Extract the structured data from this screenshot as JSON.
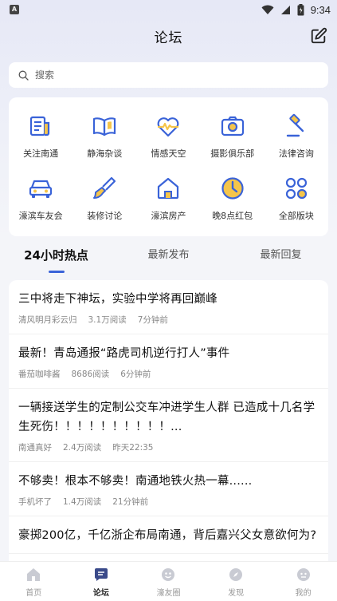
{
  "status_bar": {
    "time": "9:34",
    "left_badge": "A"
  },
  "nav": {
    "title": "论坛"
  },
  "search": {
    "placeholder": "搜索"
  },
  "categories": [
    {
      "label": "关注南通",
      "icon": "newspaper-icon"
    },
    {
      "label": "静海杂谈",
      "icon": "open-book-icon"
    },
    {
      "label": "情感天空",
      "icon": "heartbeat-icon"
    },
    {
      "label": "摄影俱乐部",
      "icon": "camera-icon"
    },
    {
      "label": "法律咨询",
      "icon": "gavel-icon"
    },
    {
      "label": "濠滨车友会",
      "icon": "car-icon"
    },
    {
      "label": "装修讨论",
      "icon": "paint-brush-icon"
    },
    {
      "label": "濠滨房产",
      "icon": "house-icon"
    },
    {
      "label": "晚8点红包",
      "icon": "clock-icon"
    },
    {
      "label": "全部版块",
      "icon": "grid-icon"
    }
  ],
  "tabs": [
    {
      "label": "24小时热点",
      "active": true
    },
    {
      "label": "最新发布",
      "active": false
    },
    {
      "label": "最新回复",
      "active": false
    }
  ],
  "posts": [
    {
      "title": "三中将走下神坛，实验中学将再回巅峰",
      "author": "清风明月彩云归",
      "reads": "3.1万阅读",
      "time": "7分钟前"
    },
    {
      "title": "最新！青岛通报“路虎司机逆行打人”事件",
      "author": "番茄咖啡酱",
      "reads": "8686阅读",
      "time": "6分钟前"
    },
    {
      "title": "一辆接送学生的定制公交车冲进学生人群 已造成十几名学生死伤！！！！！！！！！！...",
      "author": "南通真好",
      "reads": "2.4万阅读",
      "time": "昨天22:35"
    },
    {
      "title": "不够卖！根本不够卖！南通地铁火热一幕......",
      "author": "手机坏了",
      "reads": "1.4万阅读",
      "time": "21分钟前"
    },
    {
      "title": "豪掷200亿，千亿浙企布局南通，背后嘉兴父女意欲何为?",
      "author": "",
      "reads": "",
      "time": ""
    }
  ],
  "bottom_nav": [
    {
      "label": "首页",
      "icon": "home-icon",
      "active": false
    },
    {
      "label": "论坛",
      "icon": "forum-icon",
      "active": true
    },
    {
      "label": "濠友圈",
      "icon": "friends-circle-icon",
      "active": false
    },
    {
      "label": "发现",
      "icon": "compass-icon",
      "active": false
    },
    {
      "label": "我的",
      "icon": "profile-icon",
      "active": false
    }
  ],
  "colors": {
    "accent": "#3a63d8",
    "icon_blue": "#3a63d8",
    "icon_yellow": "#f5c54a"
  }
}
